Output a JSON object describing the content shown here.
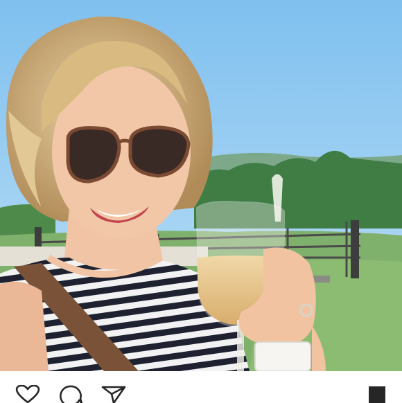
{
  "post": {
    "photo": {
      "icon": "selfie-with-wine-glass-photo",
      "colors": {
        "sky": "#8ec9f0",
        "grass": "#7fb06c",
        "hills": "#4f8f52"
      }
    },
    "actions": [
      {
        "id": "like",
        "icon": "heart-icon"
      },
      {
        "id": "comment",
        "icon": "comment-bubble-icon"
      },
      {
        "id": "share",
        "icon": "paper-plane-icon"
      },
      {
        "id": "save",
        "icon": "bookmark-icon"
      }
    ]
  }
}
